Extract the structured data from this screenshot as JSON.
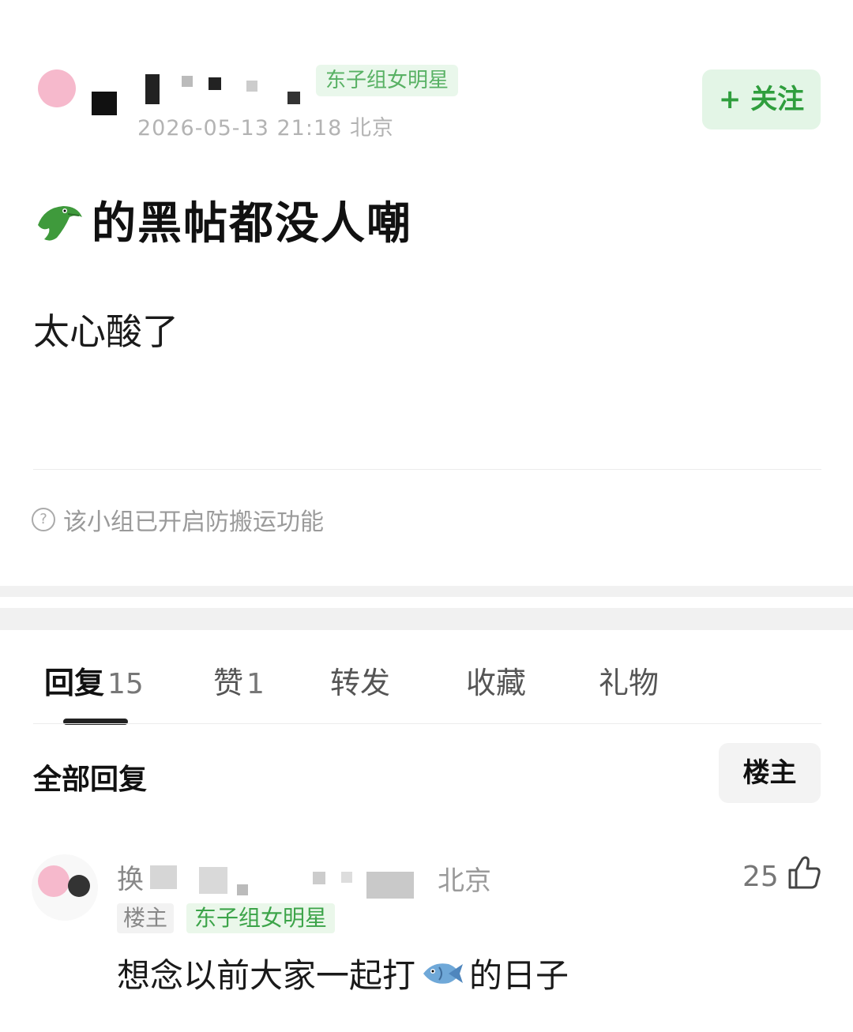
{
  "post": {
    "author_name": "",
    "group_tag": "东子组女明星",
    "meta": "2026-05-13 21:18 北京",
    "follow_label": "+ 关注",
    "title": "的黑帖都没人嘲",
    "title_icon": "crocodile-icon",
    "body": "太心酸了",
    "notice": "该小组已开启防搬运功能"
  },
  "tabs": [
    {
      "label": "回复",
      "count": "15"
    },
    {
      "label": "赞",
      "count": "1"
    },
    {
      "label": "转发",
      "count": ""
    },
    {
      "label": "收藏",
      "count": ""
    },
    {
      "label": "礼物",
      "count": ""
    }
  ],
  "replies_section": {
    "title": "全部回复",
    "op_filter": "楼主"
  },
  "reply": {
    "name": "换",
    "location": "北京",
    "badge_op": "楼主",
    "badge_group": "东子组女明星",
    "likes": "25",
    "text_before": "想念以前大家一起打",
    "text_icon": "fish-icon",
    "text_after": "的日子"
  },
  "colors": {
    "accent_green": "#2f9e3d",
    "follow_bg": "#e3f5e6",
    "text_dark": "#111111",
    "text_gray": "#9a9a9a"
  }
}
